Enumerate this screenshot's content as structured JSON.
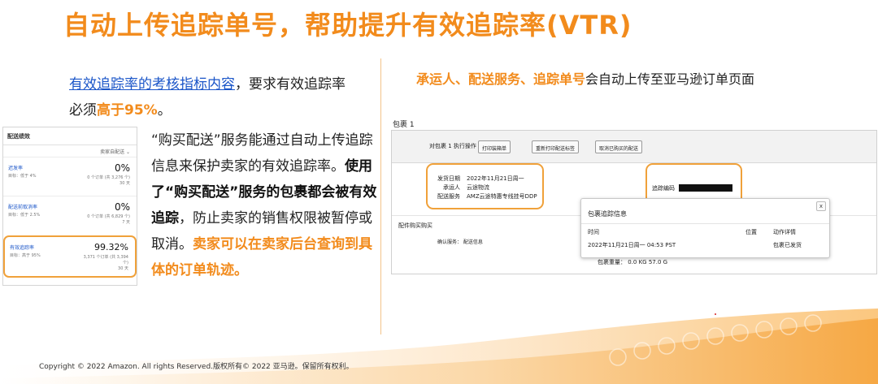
{
  "title": "自动上传追踪单号，帮助提升有效追踪率(VTR)",
  "intro": {
    "link": "有效追踪率的考核指标内容",
    "text1": "，要求有效追踪率",
    "text2": "必须",
    "highlight": "高于95%",
    "text3": "。"
  },
  "body": {
    "part1": "“购买配送”服务能通过自动上传追踪信息来保护卖家的有效追踪率。",
    "bold": "使用了“购买配送”服务的包裹都会被有效追踪",
    "part2": "，防止卖家的销售权限被暂停或取消。",
    "highlight": "卖家可以在卖家后台查询到具体的订单轨迹。"
  },
  "metrics": {
    "header": "配送绩效",
    "filter": "卖家自配送 ⌄",
    "rows": [
      {
        "label": "迟发率",
        "target": "目标：低于 4%",
        "value": "0%",
        "detail1": "0 个订单 (共 3,276 个)",
        "detail2": "30 天"
      },
      {
        "label": "配送前取消率",
        "target": "目标：低于 2.5%",
        "value": "0%",
        "detail1": "0 个订单 (共 6,829 个)",
        "detail2": "7 天"
      },
      {
        "label": "有效追踪率",
        "target": "目标：高于 95%",
        "value": "99.32%",
        "detail1": "3,371 个订单 (共 3,394",
        "detail2": "个)",
        "detail3": "30 天"
      }
    ]
  },
  "right": {
    "highlight": "承运人、配送服务、追踪单号",
    "text": "会自动上传至亚马逊订单页面"
  },
  "order": {
    "package_title": "包裹 1",
    "bar_label": "对包裹 1 执行操作",
    "buttons": [
      "打印装箱单",
      "重新打印配送标签",
      "取消已购买的配送"
    ],
    "ship_rows": [
      {
        "key": "发货日期",
        "val": "2022年11月21日周一"
      },
      {
        "key": "承运人",
        "val": "云途物流"
      },
      {
        "key": "配送服务",
        "val": "AMZ云途特惠专线挂号DDP"
      }
    ],
    "tracking_label": "追踪编码",
    "provider_label": "配件购买购买",
    "provider_service": "确认服务：   配送信息",
    "weight": "包裹重量：  0.0 KG 57.0 G"
  },
  "popup": {
    "title": "包裹追踪信息",
    "col_time": "时间",
    "col_loc": "位置",
    "col_detail": "动作详情",
    "time_value": "2022年11月21日周一 04:53 PST",
    "detail_value": "包裹已发货",
    "close": "x"
  },
  "footer": {
    "copyright": "Copyright © 2022 Amazon. All rights Reserved.版权所有© 2022 亚马逊。保留所有权利。"
  },
  "colors": {
    "accent": "#f28b1c",
    "link": "#1a55c8",
    "highlight_border": "#f0a13a"
  }
}
